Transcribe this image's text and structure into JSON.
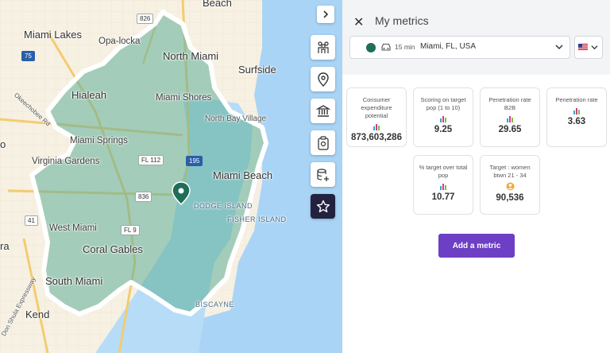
{
  "map": {
    "labels": {
      "beach_top": "Beach",
      "miami_lakes": "Miami Lakes",
      "opa_locka": "Opa-locka",
      "north_miami": "North Miami",
      "surfside": "Surfside",
      "hialeah": "Hialeah",
      "miami_shores": "Miami Shores",
      "north_bay_village": "North Bay Village",
      "miami_springs": "Miami Springs",
      "virginia_gardens": "Virginia Gardens",
      "miami_beach": "Miami Beach",
      "dodge_island": "DODGE ISLAND",
      "fisher_island": "FISHER ISLAND",
      "west_miami": "West Miami",
      "coral_gables": "Coral Gables",
      "south_miami": "South Miami",
      "biscayne": "BISCAYNE",
      "kendall": "Kend",
      "left_o": "o",
      "left_ra": "ra",
      "okeechobee": "Okeechobee Rd",
      "expressway": "Don Shula Expressway"
    },
    "shields": {
      "s826": "826",
      "s75": "75",
      "fl112": "FL 112",
      "s195": "195",
      "s836": "836",
      "s41": "41",
      "fl9": "FL 9"
    }
  },
  "toolbar": {
    "items": [
      "population-icon",
      "location-pin-icon",
      "bank-icon",
      "clipboard-icon",
      "database-add-icon",
      "star-icon"
    ]
  },
  "panel": {
    "title": "My metrics",
    "location": {
      "minutes": "15 min",
      "place": "Miami, FL, USA",
      "dot_color": "#1e6e59"
    },
    "metrics": [
      {
        "label": "Consumer expenditure potential",
        "value": "873,603,286",
        "icon": "chart-icon"
      },
      {
        "label": "Scoring on target pop (1 to 10)",
        "value": "9.25",
        "icon": "chart-icon"
      },
      {
        "label": "Penetration rate B2B",
        "value": "29.65",
        "icon": "chart-icon"
      },
      {
        "label": "Penetration rate",
        "value": "3.63",
        "icon": "chart-icon"
      },
      {
        "label": "% target over total pop",
        "value": "10.77",
        "icon": "chart-icon"
      },
      {
        "label": "Target : women btwn 21 - 34",
        "value": "90,536",
        "icon": "person-icon"
      }
    ],
    "add_button": "Add a metric",
    "accent": "#6c3fc5"
  }
}
